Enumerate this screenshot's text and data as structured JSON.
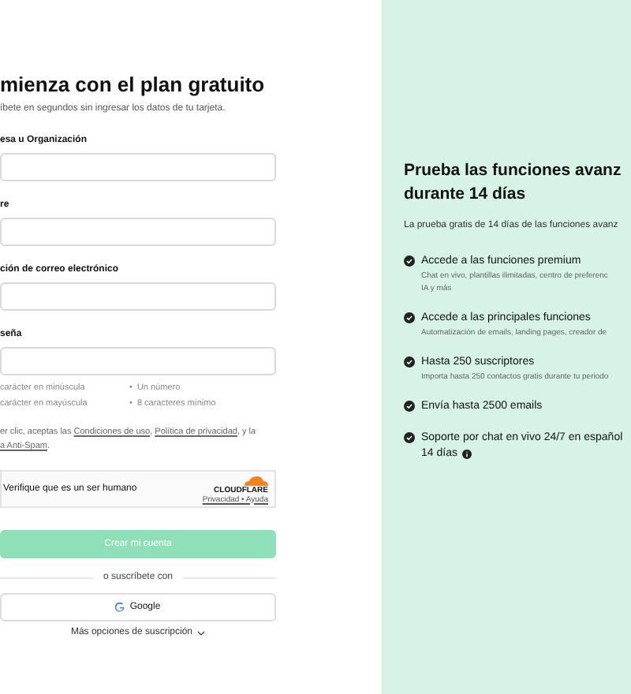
{
  "signup": {
    "title": "mienza con el plan gratuito",
    "subtitle": "íbete en segundos sin ingresar los datos de tu tarjeta.",
    "fields": [
      {
        "label": "esa u Organización"
      },
      {
        "label": "re"
      },
      {
        "label": "ción de correo electrónico"
      },
      {
        "label": "seña"
      }
    ],
    "password_rules": [
      {
        "text": "carácter en minúscula"
      },
      {
        "text": "Un número",
        "bullet": "•"
      },
      {
        "text": "carácter en mayúscula"
      },
      {
        "text": "8 caracteres mínimo",
        "bullet": "•"
      }
    ],
    "terms": [
      {
        "text": "er clic, aceptas las ",
        "link": false
      },
      {
        "text": "Condiciones de uso",
        "link": true
      },
      {
        "text": ", ",
        "link": false
      },
      {
        "text": "Política de privacidad",
        "link": true
      },
      {
        "text": ", y la ",
        "link": false
      },
      {
        "text": "a Anti-Spam",
        "link": true
      },
      {
        "text": ".",
        "link": false
      }
    ],
    "captcha": {
      "label": "Verifique que es un ser humano",
      "brand": "CLOUDFLARE",
      "links": "Privacidad • Ayuda"
    },
    "submit": {
      "label": "Crear mi cuenta",
      "disabled": true
    },
    "divider": "o suscríbete con",
    "google": {
      "label": "Google"
    },
    "more_options": "Más opciones de suscripción"
  },
  "trial": {
    "title_lines": [
      "Prueba las funciones avanz",
      "durante 14 días"
    ],
    "subtitle": "La prueba gratis de 14 días de las funciones avanz",
    "features": [
      {
        "title_lines": [
          "Accede a las funciones premium"
        ],
        "desc_lines": [
          "Chat en vivo, plantillas ilimitadas, centro de preferenc",
          "IA y más"
        ],
        "info": false
      },
      {
        "title_lines": [
          "Accede a las principales funciones"
        ],
        "desc_lines": [
          "Automatización de emails, landing pages, creador de"
        ],
        "info": false
      },
      {
        "title_lines": [
          "Hasta 250 suscriptores"
        ],
        "desc_lines": [
          "Importa hasta 250 contactos gratis durante tu periodo"
        ],
        "info": false
      },
      {
        "title_lines": [
          "Envía hasta 2500 emails"
        ],
        "info": false
      },
      {
        "title_lines": [
          "Soporte por chat en vivo 24/7 en español",
          "14 días"
        ],
        "info": true
      }
    ]
  }
}
